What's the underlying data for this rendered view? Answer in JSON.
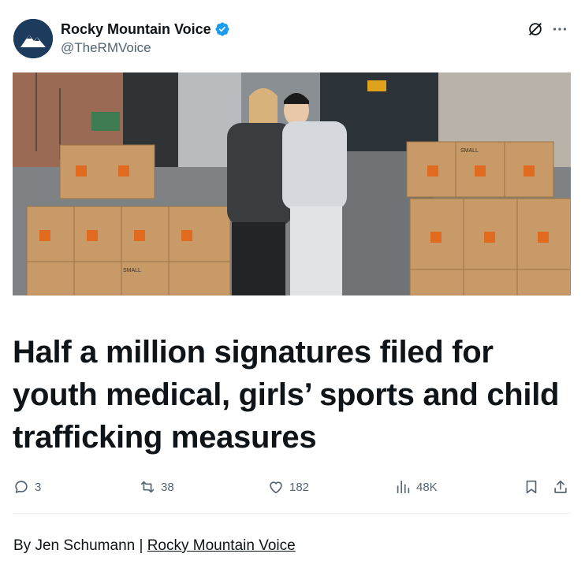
{
  "post": {
    "author_name": "Rocky Mountain Voice",
    "handle": "@TheRMVoice",
    "verified": true,
    "headline": "Half a million signatures filed for youth medical, girls’ sports and child trafficking measures",
    "byline_prefix": "By Jen Schumann | ",
    "byline_link": "Rocky Mountain Voice"
  },
  "image": {
    "box_labels": [
      "SMALL",
      "SMALL"
    ]
  },
  "metrics": {
    "replies": "3",
    "reposts": "38",
    "likes": "182",
    "views": "48K"
  },
  "colors": {
    "verified_blue": "#1d9bf0",
    "muted": "#536471",
    "avatar_bg": "#1d3b5c",
    "box_orange": "#e06b1f"
  },
  "icons": {
    "reply": "speech-bubble-icon",
    "repost": "repost-arrows-icon",
    "like": "heart-icon",
    "views": "bar-chart-icon",
    "bookmark": "bookmark-icon",
    "share": "share-upload-icon",
    "grok": "grok-slash-circle-icon",
    "more": "more-dots-icon"
  }
}
